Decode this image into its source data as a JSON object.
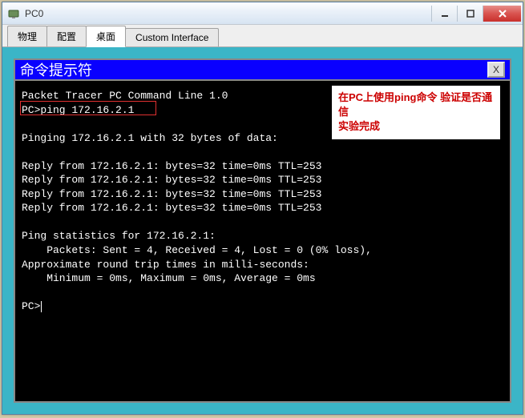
{
  "window": {
    "title": "PC0",
    "tabs": [
      {
        "label": "物理",
        "active": false
      },
      {
        "label": "配置",
        "active": false
      },
      {
        "label": "桌面",
        "active": true
      },
      {
        "label": "Custom Interface",
        "active": false
      }
    ]
  },
  "terminal": {
    "title": "命令提示符",
    "close_label": "X",
    "lines": {
      "l0": "Packet Tracer PC Command Line 1.0",
      "l1": "PC>ping 172.16.2.1",
      "l2": "",
      "l3": "Pinging 172.16.2.1 with 32 bytes of data:",
      "l4": "",
      "l5": "Reply from 172.16.2.1: bytes=32 time=0ms TTL=253",
      "l6": "Reply from 172.16.2.1: bytes=32 time=0ms TTL=253",
      "l7": "Reply from 172.16.2.1: bytes=32 time=0ms TTL=253",
      "l8": "Reply from 172.16.2.1: bytes=32 time=0ms TTL=253",
      "l9": "",
      "l10": "Ping statistics for 172.16.2.1:",
      "l11": "    Packets: Sent = 4, Received = 4, Lost = 0 (0% loss),",
      "l12": "Approximate round trip times in milli-seconds:",
      "l13": "    Minimum = 0ms, Maximum = 0ms, Average = 0ms",
      "l14": "",
      "l15": "PC>"
    }
  },
  "annotation": {
    "line1": "在PC上使用ping命令 验证是否通信",
    "line2": "实验完成"
  }
}
